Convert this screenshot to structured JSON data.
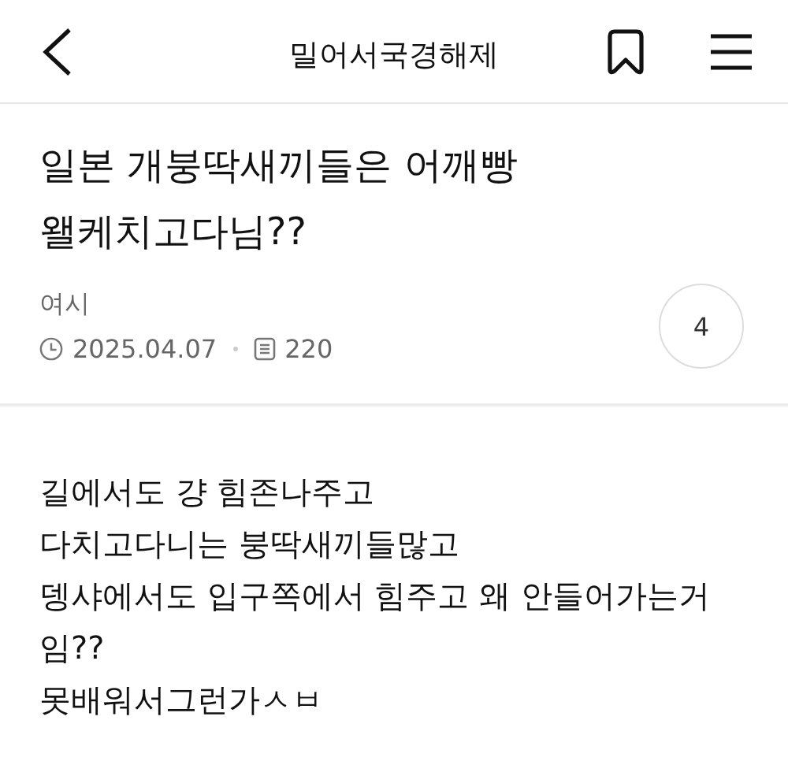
{
  "header": {
    "title": "밀어서국경해제"
  },
  "post": {
    "title": "일본 개붕딱새끼들은 어깨빵 왤케치고다님??",
    "author": "여시",
    "date": "2025.04.07",
    "views": "220",
    "comments": "4",
    "body": [
      "길에서도 걍 힘존나주고",
      "다치고다니는 붕딱새끼들많고",
      "뎅샤에서도 입구쪽에서 힘주고 왜 안들어가는거임??",
      "못배워서그런가ㅅㅂ"
    ]
  }
}
